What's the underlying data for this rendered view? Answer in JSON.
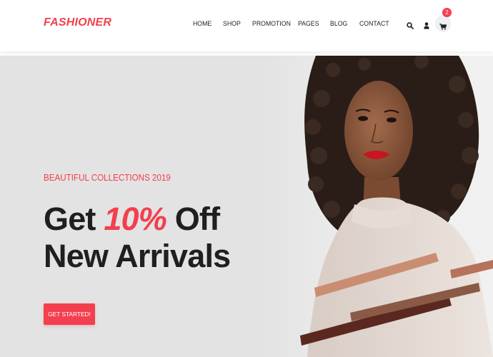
{
  "brand": {
    "name": "FASHIONER"
  },
  "nav": {
    "items": [
      {
        "label": "HOME"
      },
      {
        "label": "SHOP"
      },
      {
        "label": "PROMOTION"
      },
      {
        "label": "PAGES"
      },
      {
        "label": "BLOG"
      },
      {
        "label": "CONTACT"
      }
    ]
  },
  "header_icons": {
    "search": "search-icon",
    "account": "user-icon",
    "cart": "cart-icon",
    "cart_count": "2"
  },
  "hero": {
    "eyebrow": "BEAUTIFUL COLLECTIONS 2019",
    "headline_before": "Get ",
    "headline_accent": "10%",
    "headline_after": " Off New Arrivals",
    "cta_label": "GET STARTED!"
  },
  "colors": {
    "accent": "#f33f4e",
    "text_dark": "#1f1f1f",
    "hero_bg": "#e3e3e3"
  }
}
